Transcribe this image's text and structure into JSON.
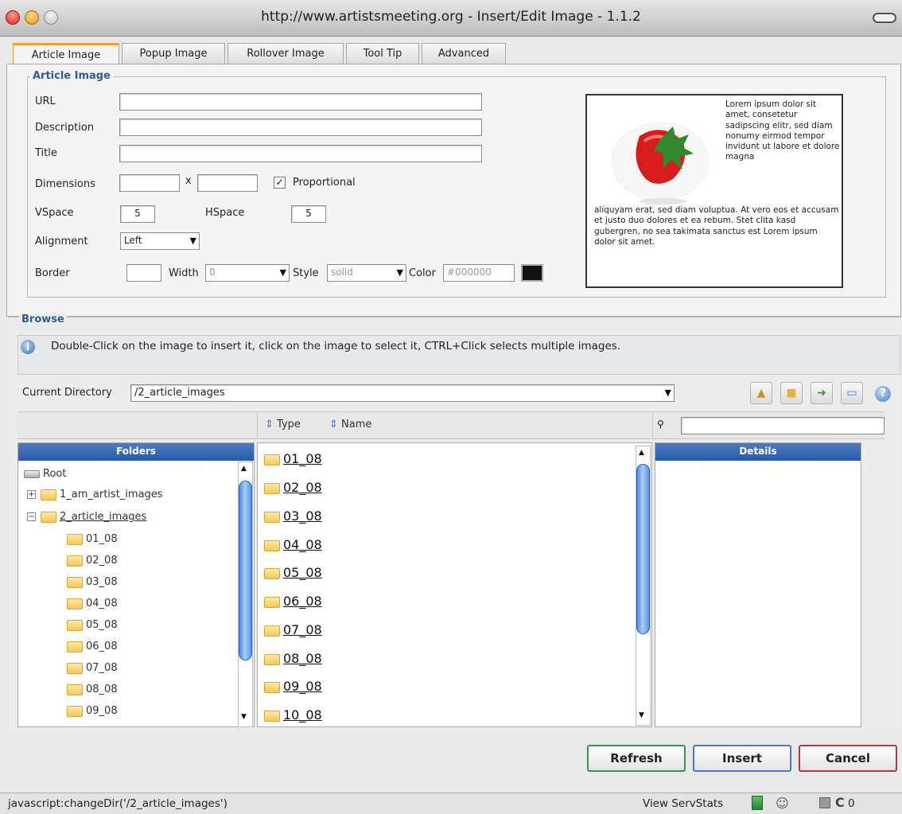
{
  "window": {
    "title": "http://www.artistsmeeting.org - Insert/Edit Image - 1.1.2"
  },
  "tabs": [
    "Article Image",
    "Popup Image",
    "Rollover Image",
    "Tool Tip",
    "Advanced"
  ],
  "article": {
    "legend": "Article Image",
    "url_label": "URL",
    "description_label": "Description",
    "title_label": "Title",
    "dimensions_label": "Dimensions",
    "dim_sep": "x",
    "proportional_label": "Proportional",
    "proportional_checked": true,
    "vspace_label": "VSpace",
    "vspace_value": "5",
    "hspace_label": "HSpace",
    "hspace_value": "5",
    "alignment_label": "Alignment",
    "alignment_value": "Left",
    "border_label": "Border",
    "width_label": "Width",
    "width_value": "0",
    "style_label": "Style",
    "style_value": "solid",
    "color_label": "Color",
    "color_value": "#000000"
  },
  "preview": {
    "text_top": "Lorem ipsum dolor sit amet, consetetur sadipscing elitr, sed diam nonumy eirmod tempor invidunt ut labore et dolore magna",
    "text_bottom": "aliquyam erat, sed diam voluptua. At vero eos et accusam et justo duo dolores et ea rebum. Stet clita kasd gubergren, no sea takimata sanctus est Lorem ipsum dolor sit amet."
  },
  "browse": {
    "legend": "Browse",
    "info_text": "Double-Click on the image to insert it, click on the image to select it, CTRL+Click selects multiple images.",
    "current_directory_label": "Current Directory",
    "current_directory_value": "/2_article_images",
    "sort_type": "Type",
    "sort_name": "Name",
    "folders_header": "Folders",
    "details_header": "Details",
    "tree": {
      "root": "Root",
      "collapsed": "1_am_artist_images",
      "expanded": "2_article_images",
      "children": [
        "01_08",
        "02_08",
        "03_08",
        "04_08",
        "05_08",
        "06_08",
        "07_08",
        "08_08",
        "09_08"
      ]
    },
    "files": [
      "01_08",
      "02_08",
      "03_08",
      "04_08",
      "05_08",
      "06_08",
      "07_08",
      "08_08",
      "09_08",
      "10_08"
    ]
  },
  "buttons": {
    "refresh": "Refresh",
    "insert": "Insert",
    "cancel": "Cancel"
  },
  "status": {
    "text": "javascript:changeDir('/2_article_images')",
    "servstats": "View ServStats",
    "count": "0"
  }
}
